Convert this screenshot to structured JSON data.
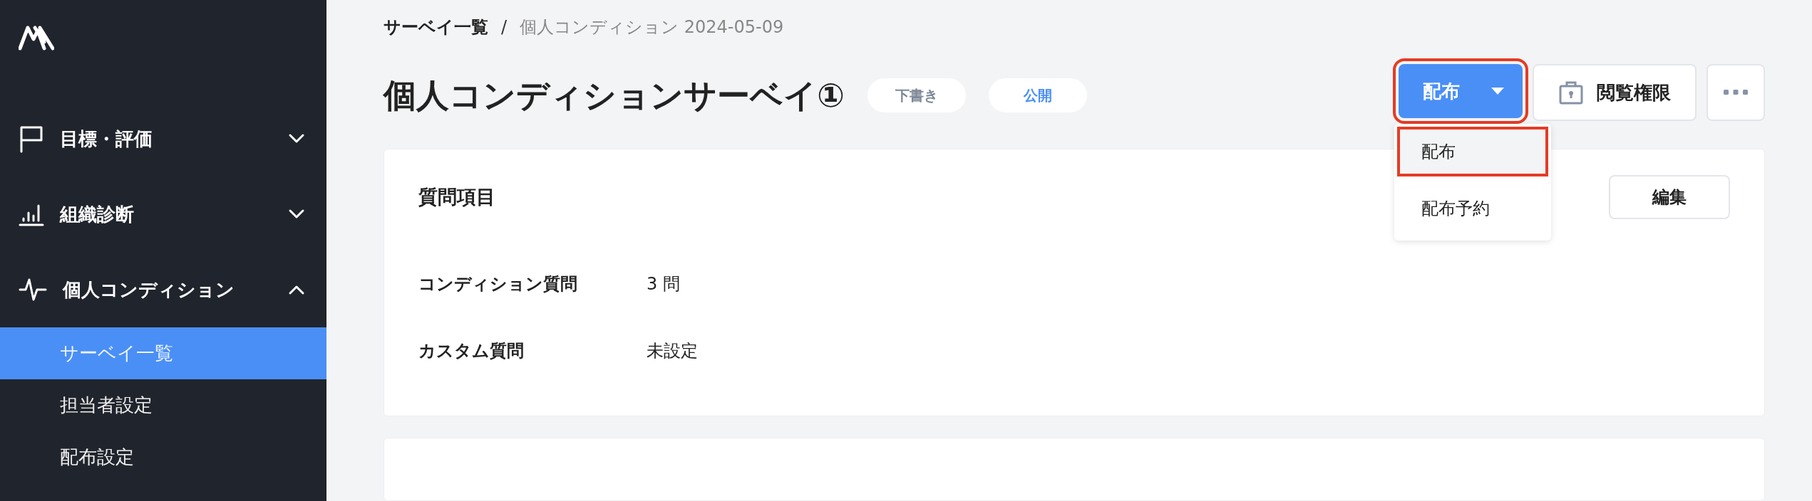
{
  "sidebar": {
    "items": [
      {
        "label": "目標・評価",
        "kind": "flag",
        "expanded": false
      },
      {
        "label": "組織診断",
        "kind": "chart",
        "expanded": false
      },
      {
        "label": "個人コンディション",
        "kind": "pulse",
        "expanded": true,
        "children": [
          {
            "label": "サーベイ一覧",
            "selected": true
          },
          {
            "label": "担当者設定",
            "selected": false
          },
          {
            "label": "配布設定",
            "selected": false
          }
        ]
      }
    ]
  },
  "breadcrumb": {
    "items": [
      {
        "label": "サーベイ一覧",
        "current": false
      },
      {
        "label": "個人コンディション 2024-05-09",
        "current": true
      }
    ],
    "separator": "/"
  },
  "header": {
    "title": "個人コンディションサーベイ①",
    "badges": [
      {
        "label": "下書き",
        "kind": "draft"
      },
      {
        "label": "公開",
        "kind": "public"
      }
    ]
  },
  "actions": {
    "distribute": {
      "label": "配布",
      "highlighted": true,
      "menu_open": true,
      "menu": [
        {
          "label": "配布",
          "highlighted": true
        },
        {
          "label": "配布予約",
          "highlighted": false
        }
      ]
    },
    "permissions": {
      "label": "閲覧権限"
    }
  },
  "cards": [
    {
      "title": "質問項目",
      "edit_label": "編集",
      "rows": [
        {
          "label": "コンディション質問",
          "value": "3 問"
        },
        {
          "label": "カスタム質問",
          "value": "未設定"
        }
      ]
    }
  ]
}
